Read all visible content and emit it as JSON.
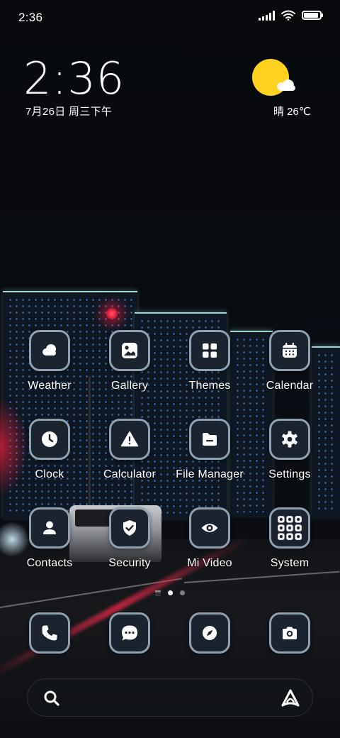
{
  "status_bar": {
    "time": "2:36",
    "battery_percent": 90
  },
  "clock_widget": {
    "time": "2:36",
    "date": "7月26日 周三下午"
  },
  "weather_widget": {
    "condition_icon": "sunny-partly-cloudy-icon",
    "text": "晴 26℃"
  },
  "apps": [
    {
      "label": "Weather",
      "icon": "weather-icon"
    },
    {
      "label": "Gallery",
      "icon": "gallery-icon"
    },
    {
      "label": "Themes",
      "icon": "themes-icon"
    },
    {
      "label": "Calendar",
      "icon": "calendar-icon"
    },
    {
      "label": "Clock",
      "icon": "clock-icon"
    },
    {
      "label": "Calculator",
      "icon": "calculator-icon"
    },
    {
      "label": "File Manager",
      "icon": "file-manager-icon"
    },
    {
      "label": "Settings",
      "icon": "settings-icon"
    },
    {
      "label": "Contacts",
      "icon": "contacts-icon"
    },
    {
      "label": "Security",
      "icon": "security-icon"
    },
    {
      "label": "Mi Video",
      "icon": "mi-video-icon"
    },
    {
      "label": "System",
      "icon": "system-folder-icon"
    }
  ],
  "pager": {
    "pages": 2,
    "active_page": 1
  },
  "dock": [
    {
      "name": "phone",
      "icon": "phone-icon"
    },
    {
      "name": "messages",
      "icon": "messages-icon"
    },
    {
      "name": "browser",
      "icon": "compass-icon"
    },
    {
      "name": "camera",
      "icon": "camera-icon"
    }
  ],
  "search_bar": {
    "left_icon": "search-icon",
    "right_icon": "assistant-icon"
  },
  "colors": {
    "tile_bg": "#1b242e",
    "tile_border": "#8fa1b1",
    "sun": "#ffd21f"
  }
}
